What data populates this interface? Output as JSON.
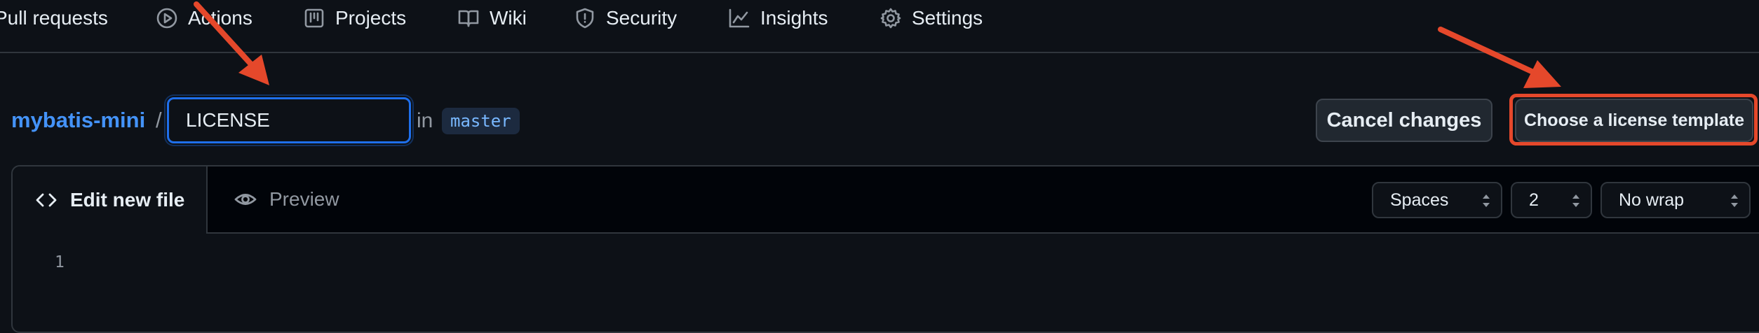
{
  "nav": {
    "items": [
      {
        "label": "Pull requests",
        "icon": "pull-request-icon"
      },
      {
        "label": "Actions",
        "icon": "play-circle-icon"
      },
      {
        "label": "Projects",
        "icon": "project-board-icon"
      },
      {
        "label": "Wiki",
        "icon": "book-icon"
      },
      {
        "label": "Security",
        "icon": "shield-icon"
      },
      {
        "label": "Insights",
        "icon": "graph-icon"
      },
      {
        "label": "Settings",
        "icon": "gear-icon"
      }
    ]
  },
  "breadcrumb": {
    "repo": "mybatis-mini",
    "separator": "/",
    "filename_value": "LICENSE",
    "in_label": "in",
    "branch": "master"
  },
  "actions": {
    "cancel_label": "Cancel changes",
    "template_label": "Choose a license template"
  },
  "editor": {
    "tabs": {
      "edit_label": "Edit new file",
      "preview_label": "Preview"
    },
    "indent_mode": "Spaces",
    "indent_size": "2",
    "wrap_mode": "No wrap",
    "line_numbers": [
      "1"
    ]
  },
  "annotations": {
    "arrow_color": "#e5482b",
    "highlight_color": "#e5482b"
  },
  "colors": {
    "background": "#0d1117",
    "link": "#4493f8",
    "focus": "#1f6feb"
  }
}
